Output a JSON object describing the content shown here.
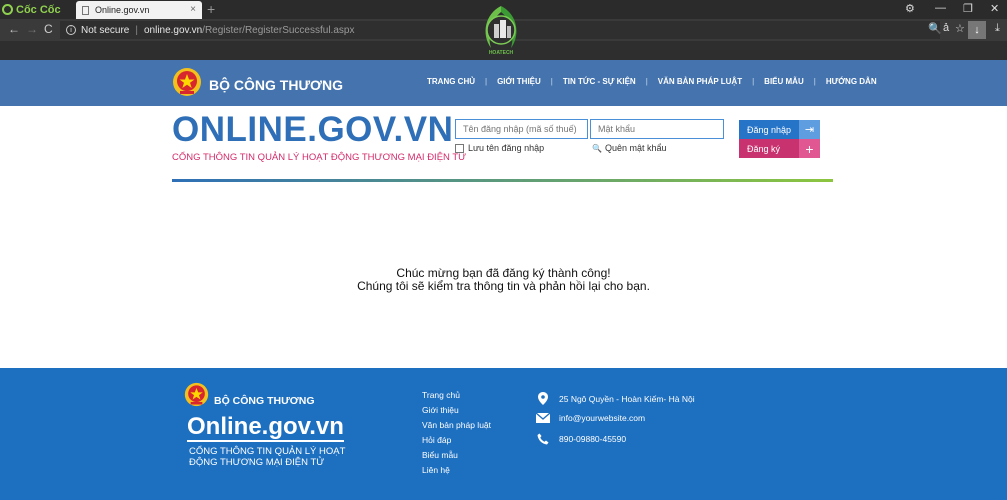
{
  "browser": {
    "logo_text": "Cốc Cốc",
    "tab_title": "Online.gov.vn",
    "tab_close": "×",
    "new_tab": "+",
    "window_buttons": [
      "⚙",
      "—",
      "❐",
      "✕"
    ],
    "nav": {
      "back": "←",
      "forward": "→",
      "reload": "C"
    },
    "security_label": "Not secure",
    "url_domain": "online.gov.vn",
    "url_path": "/Register/RegisterSuccessful.aspx",
    "toolbar": {
      "zoom": "🔍",
      "translate": "ả",
      "star": "☆",
      "download": "↓",
      "extra_download": "⤓"
    },
    "watermark_text": "HOATECH"
  },
  "header": {
    "brand": "BỘ CÔNG THƯƠNG",
    "menu": [
      "TRANG CHỦ",
      "GIỚI THIỆU",
      "TIN TỨC - SỰ KIỆN",
      "VĂN BẢN PHÁP LUẬT",
      "BIỂU MẪU",
      "HƯỚNG DẪN"
    ],
    "menu_separator": "|"
  },
  "masthead": {
    "title": "ONLINE.GOV.VN",
    "tagline": "CỔNG THÔNG TIN QUẢN LÝ HOẠT ĐỘNG THƯƠNG MẠI ĐIỆN TỬ",
    "username_placeholder": "Tên đăng nhập (mã số thuế)",
    "password_placeholder": "Mật khẩu",
    "remember_label": "Lưu tên đăng nhập",
    "forgot_label": "Quên mật khẩu",
    "forgot_icon": "🔍",
    "login_label": "Đăng nhập",
    "login_icon": "⇥",
    "register_label": "Đăng ký",
    "register_icon": "+"
  },
  "message": {
    "line1": "Chúc mừng bạn đã đăng ký thành công!",
    "line2": "Chúng tôi sẽ kiểm tra thông tin và phản hồi lại cho bạn."
  },
  "footer": {
    "brand": "BỘ CÔNG THƯƠNG",
    "logo": "Online.gov.vn",
    "tagline": "CỔNG THÔNG TIN QUẢN LÝ HOẠT ĐỘNG THƯƠNG MẠI ĐIỆN TỬ",
    "links": [
      "Trang chủ",
      "Giới thiệu",
      "Văn bản pháp luật",
      "Hỏi đáp",
      "Biểu mẫu",
      "Liên hệ"
    ],
    "address": "25 Ngô Quyền - Hoàn Kiếm- Hà Nội",
    "email": "info@yourwebsite.com",
    "phone": "890-09880-45590"
  },
  "colors": {
    "nav_bg": "#4473ad",
    "title_blue": "#2e6fb7",
    "tagline_pink": "#d42a6a",
    "login_blue": "#2574c8",
    "register_pink": "#c8336f",
    "footer_bg": "#1d6fc0"
  }
}
